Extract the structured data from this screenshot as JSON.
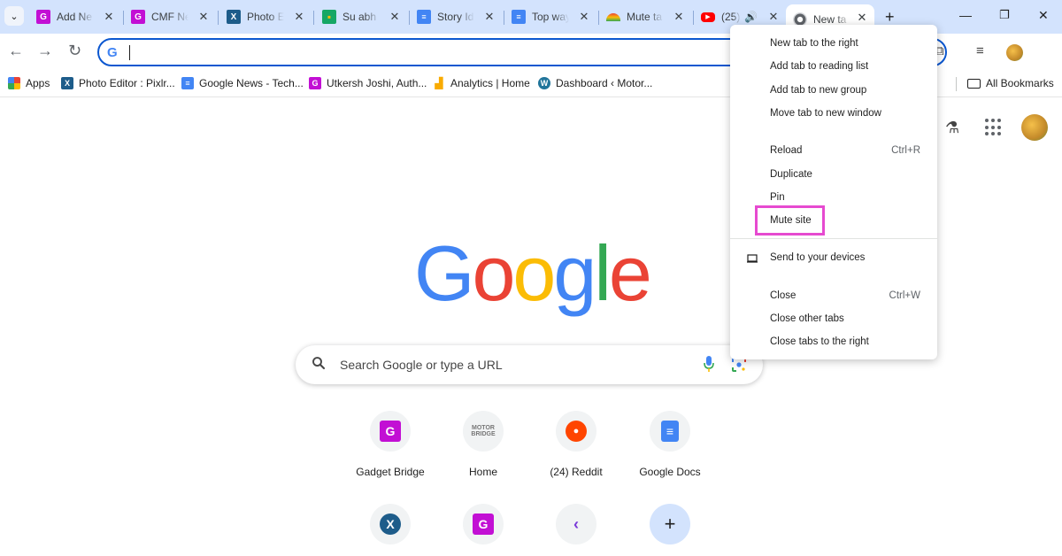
{
  "tabs": [
    {
      "title": "Add Ne",
      "favicon": "gadget-bridge-icon",
      "color": "#c20fd4",
      "active": false
    },
    {
      "title": "CMF Ne",
      "favicon": "gadget-bridge-icon",
      "color": "#c20fd4",
      "active": false
    },
    {
      "title": "Photo E",
      "favicon": "pixlr-icon",
      "color": "#1d5c8a",
      "active": false
    },
    {
      "title": "Su abh I",
      "favicon": "chat-icon",
      "color": "#16a765",
      "active": false
    },
    {
      "title": "Story Id",
      "favicon": "google-docs-icon",
      "color": "#4285f4",
      "active": false
    },
    {
      "title": "Top way",
      "favicon": "google-docs-icon",
      "color": "#4285f4",
      "active": false
    },
    {
      "title": "Mute ta",
      "favicon": "rainbow-icon",
      "color": "#e8710a",
      "active": false
    },
    {
      "title": "(25)",
      "favicon": "youtube-icon",
      "color": "#ff0000",
      "active": false,
      "audio": true
    },
    {
      "title": "New ta",
      "favicon": "chrome-icon",
      "color": "#5f6368",
      "active": true
    }
  ],
  "toolbar": {
    "omnibox_value": ""
  },
  "bookmarks": [
    {
      "label": "Apps",
      "icon": "apps-grid-icon"
    },
    {
      "label": "Photo Editor : Pixlr...",
      "icon": "pixlr-icon"
    },
    {
      "label": "Google News - Tech...",
      "icon": "google-news-icon"
    },
    {
      "label": "Utkersh Joshi, Auth...",
      "icon": "gadget-bridge-icon"
    },
    {
      "label": "Analytics | Home",
      "icon": "analytics-icon"
    },
    {
      "label": "Dashboard ‹ Motor...",
      "icon": "wordpress-icon"
    }
  ],
  "all_bookmarks": "All Bookmarks",
  "search": {
    "placeholder": "Search Google or type a URL"
  },
  "shortcuts": [
    {
      "label": "Gadget Bridge",
      "icon": "gadget-bridge-icon"
    },
    {
      "label": "Home",
      "icon": "motor-bridge-icon"
    },
    {
      "label": "(24) Reddit",
      "icon": "reddit-icon"
    },
    {
      "label": "Google Docs",
      "icon": "google-docs-icon"
    },
    {
      "label": "",
      "icon": "pixlr-icon"
    },
    {
      "label": "",
      "icon": "gadget-bridge-icon"
    },
    {
      "label": "",
      "icon": "purple-k-icon"
    },
    {
      "label": "",
      "icon": "plus-icon"
    }
  ],
  "context_menu": {
    "group1": [
      "New tab to the right",
      "Add tab to reading list",
      "Add tab to new group",
      "Move tab to new window"
    ],
    "reload": {
      "label": "Reload",
      "shortcut": "Ctrl+R"
    },
    "duplicate": "Duplicate",
    "pin": "Pin",
    "mute": "Mute site",
    "send": "Send to your devices",
    "close": {
      "label": "Close",
      "shortcut": "Ctrl+W"
    },
    "close_other": "Close other tabs",
    "close_right": "Close tabs to the right"
  },
  "colors": {
    "highlight": "#e64ad0",
    "tabstrip": "#d3e3fd",
    "focus": "#0b57d0"
  }
}
